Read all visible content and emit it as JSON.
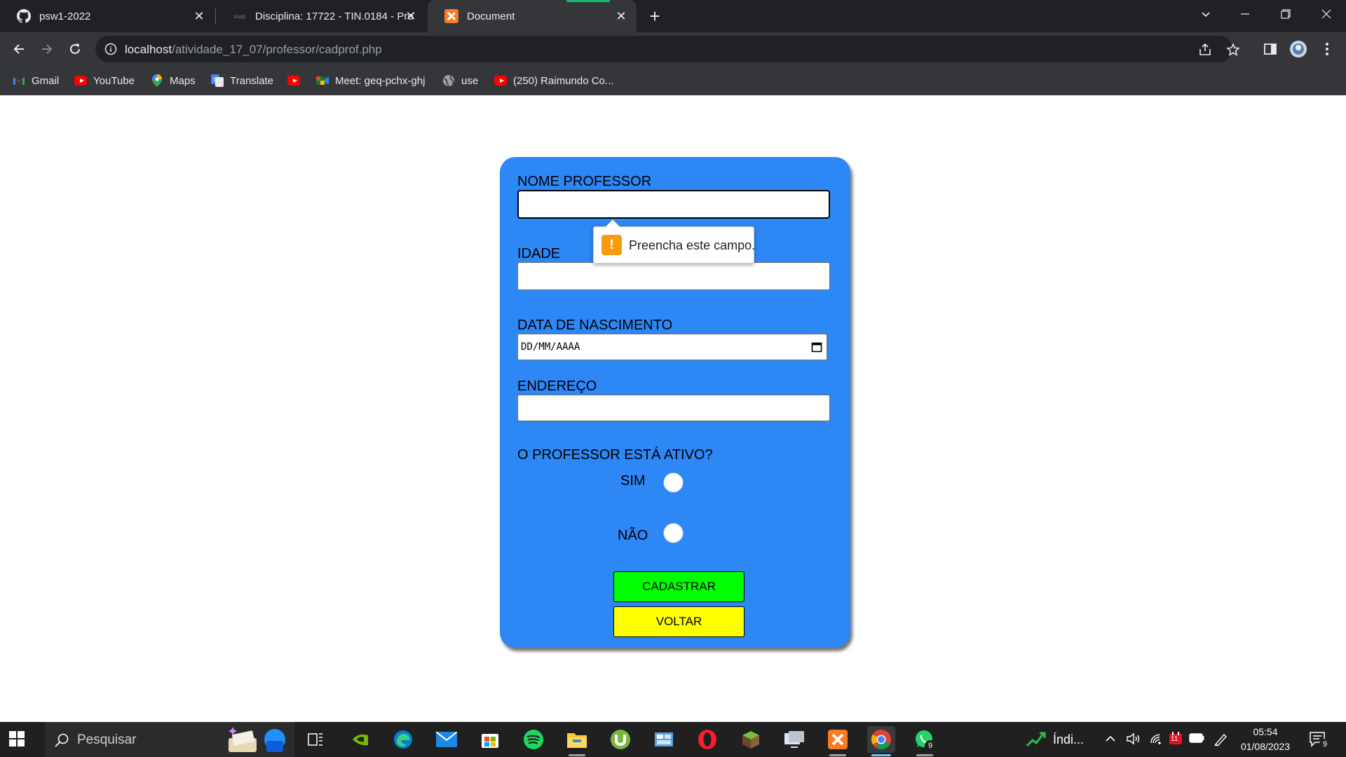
{
  "browser": {
    "tabs": [
      {
        "title": "psw1-2022",
        "icon": "github-icon"
      },
      {
        "title": "Disciplina: 17722 - TIN.0184 - Pro",
        "icon": "suap-icon",
        "favicon_text": "suap"
      },
      {
        "title": "Document",
        "icon": "xampp-icon"
      }
    ],
    "new_tab_label": "+",
    "url_host": "localhost",
    "url_path": "/atividade_17_07/professor/cadprof.php",
    "bookmarks": [
      {
        "label": "Gmail",
        "icon": "gmail-icon"
      },
      {
        "label": "YouTube",
        "icon": "youtube-icon"
      },
      {
        "label": "Maps",
        "icon": "maps-icon"
      },
      {
        "label": "Translate",
        "icon": "translate-icon"
      },
      {
        "label": "",
        "icon": "youtube-icon"
      },
      {
        "label": "Meet: geq-pchx-ghj",
        "icon": "meet-icon"
      },
      {
        "label": "use",
        "icon": "globe-icon"
      },
      {
        "label": "(250) Raimundo Co...",
        "icon": "youtube-icon"
      }
    ]
  },
  "form": {
    "name_label": "NOME PROFESSOR",
    "name_value": "",
    "age_label": "IDADE",
    "age_value": "",
    "birth_label": "DATA DE NASCIMENTO",
    "birth_placeholder": "DD/MM/AAAA",
    "address_label": "ENDEREÇO",
    "address_value": "",
    "active_question": "O PROFESSOR ESTÁ ATIVO?",
    "option_yes": "SIM",
    "option_no": "NÃO",
    "submit_label": "CADASTRAR",
    "back_label": "VOLTAR",
    "validation_message": "Preencha este campo.",
    "colors": {
      "card": "#2d87f5",
      "submit": "#00ff00",
      "back": "#ffff00"
    }
  },
  "taskbar": {
    "search_placeholder": "Pesquisar",
    "whatsapp_badge": "9",
    "stock_widget": "Índi...",
    "calendar_badge": "11",
    "time": "05:54",
    "date": "01/08/2023",
    "notification_count": "9"
  }
}
